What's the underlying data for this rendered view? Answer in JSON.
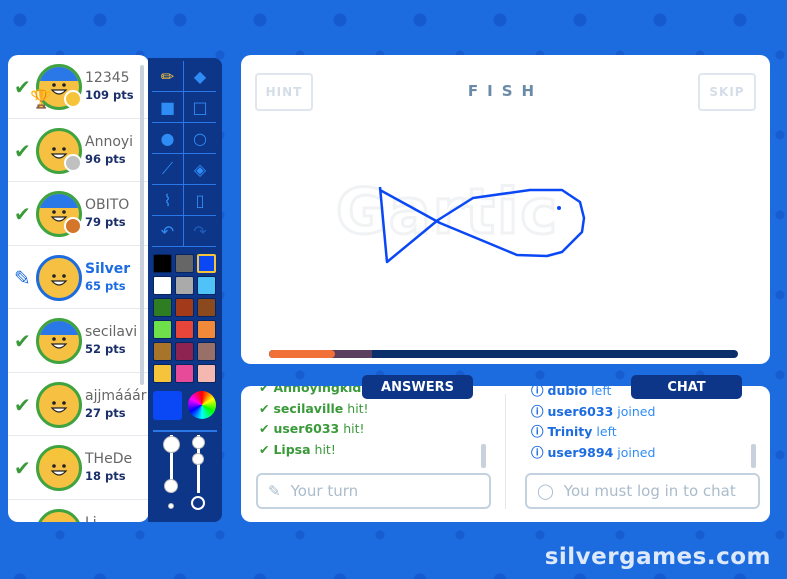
{
  "players": [
    {
      "name": "12345",
      "points": "109 pts",
      "status": "check",
      "badge": "#f5c43a",
      "hair": "#2a78e8",
      "rank": "1"
    },
    {
      "name": "Annoyi",
      "points": "96 pts",
      "status": "check",
      "badge": "#c0c0c0",
      "hair": ""
    },
    {
      "name": "OBITO",
      "points": "79 pts",
      "status": "check",
      "badge": "#d4762a",
      "hair": "#2a78e8"
    },
    {
      "name": "Silver",
      "points": "65 pts",
      "status": "drawing",
      "badge": "",
      "hair": ""
    },
    {
      "name": "secilavi",
      "points": "52 pts",
      "status": "check",
      "badge": "",
      "hair": "#2a78e8"
    },
    {
      "name": "ajjmááár",
      "points": "27 pts",
      "status": "check",
      "badge": "",
      "hair": ""
    },
    {
      "name": "THeDe",
      "points": "18 pts",
      "status": "check",
      "badge": "",
      "hair": "#f5c43a"
    },
    {
      "name": "Li",
      "points": "",
      "status": "",
      "badge": "",
      "hair": ""
    }
  ],
  "tools": [
    "pencil-icon",
    "eraser-icon",
    "filled-rect-icon",
    "rect-icon",
    "filled-circle-icon",
    "circle-icon",
    "line-icon",
    "fill-bucket-icon",
    "eyedropper-icon",
    "new-page-icon",
    "undo-icon",
    "redo-icon"
  ],
  "palette": [
    "#000000",
    "#666666",
    "#0b48f5",
    "#ffffff",
    "#aaaaaa",
    "#4fc3f7",
    "#2e7d22",
    "#a33a1a",
    "#8b4a1e",
    "#6ee04a",
    "#e8453a",
    "#f08a3a",
    "#a8742a",
    "#8e2250",
    "#987068",
    "#f5c43a",
    "#e84a9a",
    "#f4b8b0"
  ],
  "selected_color": "#0b48f5",
  "canvas": {
    "hint_label": "HINT",
    "skip_label": "SKIP",
    "word": "FISH",
    "watermark": "Gartic",
    "timer_progress": 0.14,
    "timer_pending": 0.22
  },
  "tabs": {
    "answers": "ANSWERS",
    "chat": "CHAT"
  },
  "answers": [
    {
      "user": "Annoyingkid",
      "text": "hit!"
    },
    {
      "user": "secilaville",
      "text": "hit!"
    },
    {
      "user": "user6033",
      "text": "hit!"
    },
    {
      "user": "Lipsa",
      "text": "hit!"
    }
  ],
  "chat": [
    {
      "user": "dubio",
      "text": "left"
    },
    {
      "user": "user6033",
      "text": "joined"
    },
    {
      "user": "Trinity",
      "text": "left"
    },
    {
      "user": "user9894",
      "text": "joined"
    }
  ],
  "answer_input": {
    "placeholder": "Your turn"
  },
  "chat_input": {
    "placeholder": "You must log in to chat"
  },
  "site_watermark": "silvergames.com",
  "colors": {
    "background": "#1c6ce0",
    "panel": "#0d3588",
    "correct": "#3a9a3a",
    "info": "#2f8cf5",
    "timer": "#f07038"
  }
}
